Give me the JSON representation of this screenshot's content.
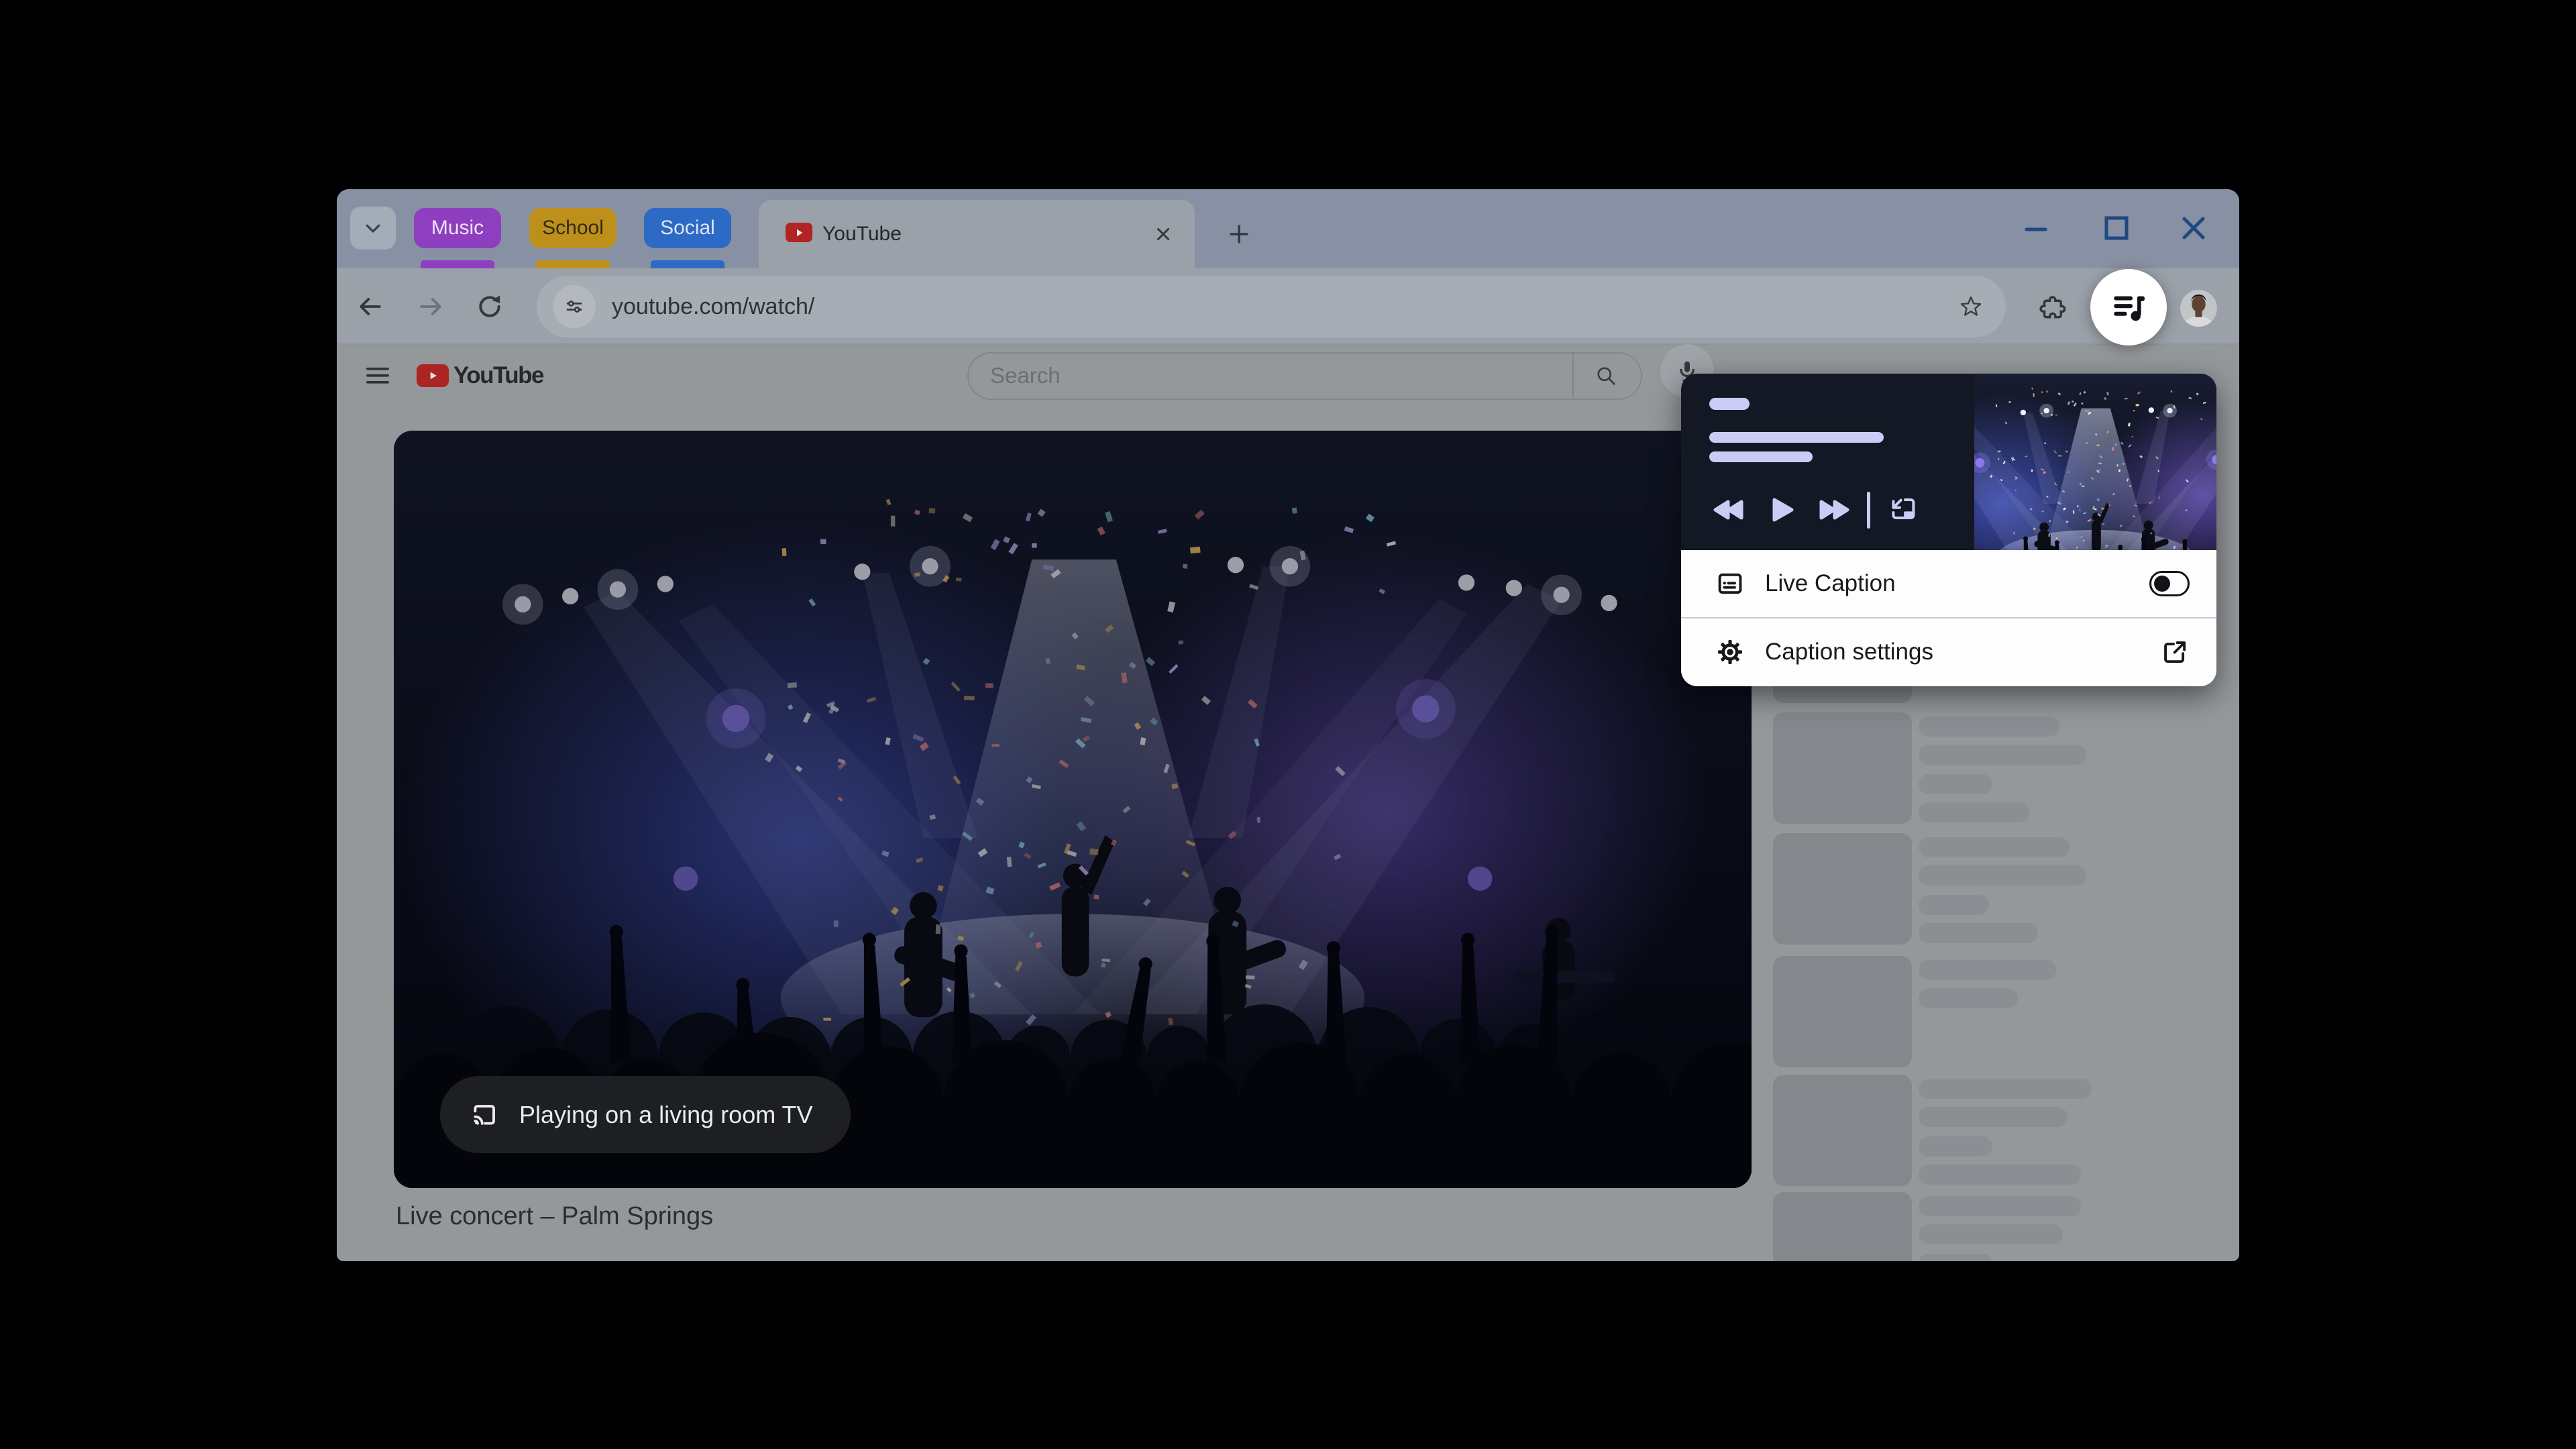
{
  "tab_strip": {
    "groups": [
      {
        "label": "Music",
        "color": "#8e3fc0"
      },
      {
        "label": "School",
        "color": "#bd901c"
      },
      {
        "label": "Social",
        "color": "#2d6ac6"
      }
    ],
    "active_tab": {
      "title": "YouTube"
    }
  },
  "toolbar": {
    "url": "youtube.com/watch/"
  },
  "youtube": {
    "search_placeholder": "Search",
    "video": {
      "title": "Live concert – Palm Springs",
      "cast_label": "Playing on a living room TV"
    }
  },
  "media_popup": {
    "rows": [
      {
        "label": "Live Caption",
        "type": "toggle",
        "enabled": false
      },
      {
        "label": "Caption settings",
        "type": "external-link"
      }
    ]
  },
  "sidebar": {
    "items": [
      {
        "lines": []
      },
      {
        "lines": [
          210,
          250,
          110,
          165
        ]
      },
      {
        "lines": [
          225,
          250,
          105,
          178
        ]
      },
      {
        "lines": [
          205,
          148
        ]
      },
      {
        "lines": [
          258,
          222,
          110,
          242
        ]
      },
      {
        "lines": [
          242,
          215,
          110
        ]
      }
    ]
  },
  "colors": {
    "popup_dark": "#141824",
    "popup_accent": "#c9cdf6",
    "youtube_red": "#ad2424",
    "window_controls": "#1f4783",
    "spotlight": "#ffffff"
  }
}
